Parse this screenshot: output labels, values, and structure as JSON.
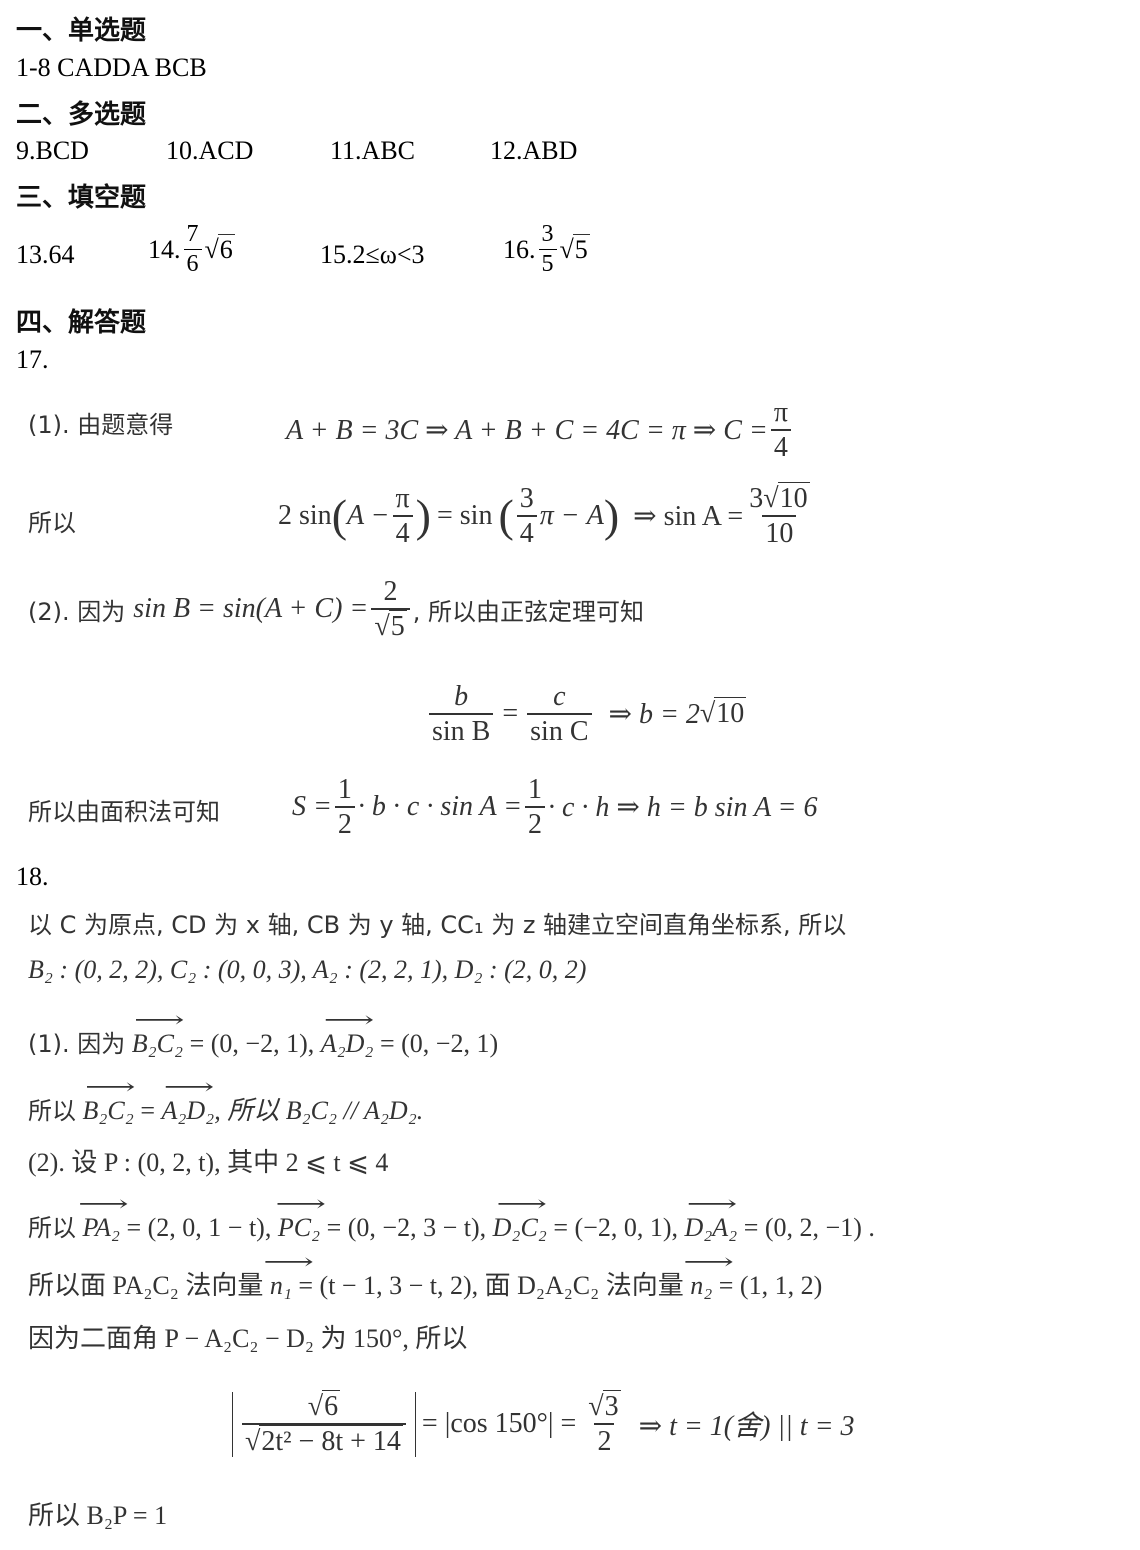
{
  "sections": {
    "s1_title": "一、单选题",
    "s1_answers": "1-8 CADDA BCB",
    "s2_title": "二、多选题",
    "s2_answers": [
      {
        "num": "9.",
        "ans": "BCD"
      },
      {
        "num": "10.",
        "ans": "ACD"
      },
      {
        "num": "11.",
        "ans": "ABC"
      },
      {
        "num": "12.",
        "ans": "ABD"
      }
    ],
    "s3_title": "三、填空题",
    "s3_answers": {
      "q13": "13.64",
      "q14_label": "14.",
      "q14_num": "7",
      "q14_den": "6",
      "q14_rad": "6",
      "q15": "15.2≤ω<3",
      "q16_label": "16.",
      "q16_num": "3",
      "q16_den": "5",
      "q16_rad": "5"
    },
    "s4_title": "四、解答题"
  },
  "q17": {
    "number": "17.",
    "p1_label": "(1). 由题意得",
    "p1_eq": "A + B = 3C  ⇒  A + B + C = 4C = π  ⇒  C =",
    "p1_frac_num": "π",
    "p1_frac_den": "4",
    "p1b_label": "所以",
    "p1b_lhs": "2 sin",
    "p1b_inner1": "A −",
    "p1b_f1_num": "π",
    "p1b_f1_den": "4",
    "p1b_mid": "= sin",
    "p1b_f2_num": "3",
    "p1b_f2_den": "4",
    "p1b_inner2": "π − A",
    "p1b_rhs": "⇒  sin A =",
    "p1b_res_num_coef": "3",
    "p1b_res_num_rad": "10",
    "p1b_res_den": "10",
    "p2_label": "(2). 因为",
    "p2_eq": "sin B = sin(A + C) =",
    "p2_frac_num": "2",
    "p2_frac_den_rad": "5",
    "p2_tail": ", 所以由正弦定理可知",
    "p2b_f1_num": "b",
    "p2b_f1_den": "sin B",
    "p2b_eq": "=",
    "p2b_f2_num": "c",
    "p2b_f2_den": "sin C",
    "p2b_rhs": "⇒  b = 2",
    "p2b_rhs_rad": "10",
    "p2c_label": "所以由面积法可知",
    "p2c_s": "S =",
    "p2c_half1_num": "1",
    "p2c_half1_den": "2",
    "p2c_mid": "· b · c · sin A =",
    "p2c_half2_num": "1",
    "p2c_half2_den": "2",
    "p2c_tail": "· c · h  ⇒  h = b sin A = 6"
  },
  "q18": {
    "number": "18.",
    "setup": "以 C 为原点, CD 为 x 轴, CB 为 y 轴, CC₁ 为 z 轴建立空间直角坐标系, 所以",
    "coords": "B₂ : (0, 2, 2), C₂ : (0, 0, 3), A₂ : (2, 2, 1), D₂ : (2, 0, 2)",
    "p1_label": "(1). 因为",
    "p1_v1": "B₂C₂",
    "p1_v1_val": " = (0, −2, 1), ",
    "p1_v2": "A₂D₂",
    "p1_v2_val": " = (0, −2, 1)",
    "p1b_label": "所以",
    "p1b_v1": "B₂C₂",
    "p1b_eq": " = ",
    "p1b_v2": "A₂D₂",
    "p1b_tail": ", 所以 B₂C₂ // A₂D₂.",
    "p2_line1": "(2). 设 P : (0, 2, t), 其中 2 ⩽ t ⩽ 4",
    "p2_line2_label": "所以",
    "p2_vecs": [
      {
        "name": "PA₂",
        "val": " = (2, 0, 1 − t), "
      },
      {
        "name": "PC₂",
        "val": " = (0, −2, 3 − t), "
      },
      {
        "name": "D₂C₂",
        "val": " = (−2, 0, 1), "
      },
      {
        "name": "D₂A₂",
        "val": " = (0, 2, −1) ."
      }
    ],
    "p2_line3_a": "所以面 PA₂C₂ 法向量 ",
    "p2_line3_n1": "n₁",
    "p2_line3_b": " = (t − 1, 3 − t, 2), 面 D₂A₂C₂ 法向量 ",
    "p2_line3_n2": "n₂",
    "p2_line3_c": " = (1, 1, 2)",
    "p2_line4": "因为二面角 P − A₂C₂ − D₂ 为 150°, 所以",
    "p2_eq_num_rad": "6",
    "p2_eq_den_rad": "2t² − 8t + 14",
    "p2_eq_mid": "= |cos 150°| =",
    "p2_eq_f_num_rad": "3",
    "p2_eq_f_den": "2",
    "p2_eq_tail": "⇒  t = 1(舍) || t = 3",
    "conclusion": "所以 B₂P = 1"
  }
}
